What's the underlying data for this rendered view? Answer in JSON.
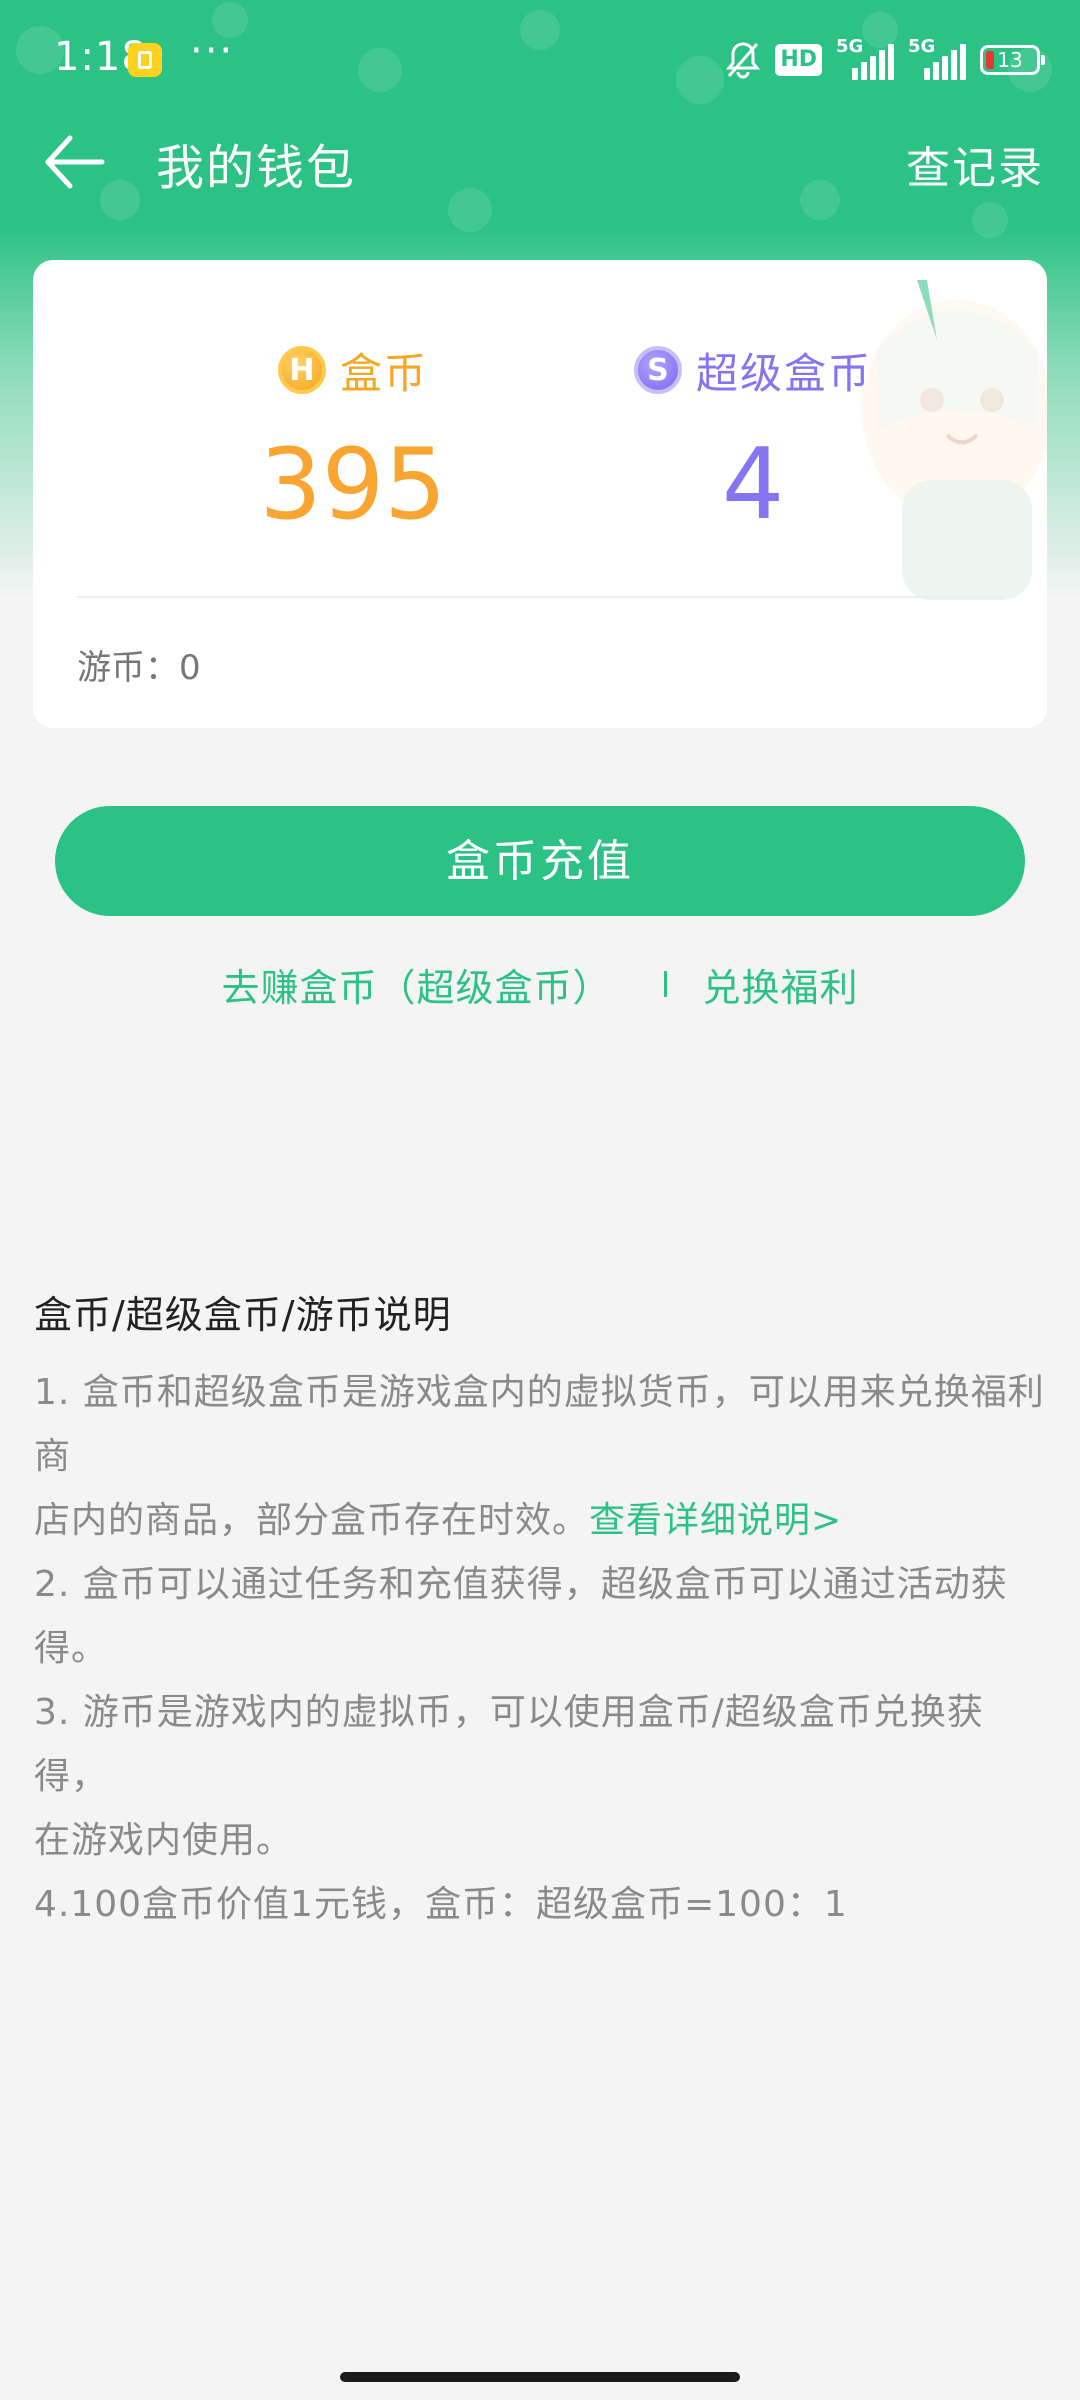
{
  "status_bar": {
    "time": "1:18",
    "dots": "···",
    "hd_label": "HD",
    "network_1": "5G",
    "network_2": "5G",
    "battery_level": "13"
  },
  "nav": {
    "title": "我的钱包",
    "records_label": "查记录"
  },
  "wallet": {
    "coins_label": "盒币",
    "coins_value": "395",
    "coins_icon_glyph": "H",
    "super_coins_label": "超级盒币",
    "super_coins_value": "4",
    "super_coins_icon_glyph": "S",
    "game_coins_text": "游币：0"
  },
  "actions": {
    "recharge_label": "盒币充值",
    "earn_link": "去赚盒币（超级盒币）",
    "redeem_link": "兑换福利"
  },
  "explanation": {
    "title": "盒币/超级盒币/游币说明",
    "line1_a": "1. 盒币和超级盒币是游戏盒内的虚拟货币，可以用来兑换福利商",
    "line1_b": "店内的商品，部分盒币存在时效。",
    "line1_link": "查看详细说明>",
    "line2": "2. 盒币可以通过任务和充值获得，超级盒币可以通过活动获得。",
    "line3_a": "3. 游币是游戏内的虚拟币，可以使用盒币/超级盒币兑换获得，",
    "line3_b": "在游戏内使用。",
    "line4": "4.100盒币价值1元钱，盒币：超级盒币=100：1"
  },
  "colors": {
    "brand_green": "#2dc285",
    "coin_gold": "#f9a532",
    "super_violet": "#8675f2",
    "battery_low": "#e53935"
  },
  "icons": {
    "back": "arrow-left-icon",
    "bell_muted": "bell-off-icon",
    "coin": "gold-coin-icon",
    "super_coin": "violet-coin-icon"
  }
}
